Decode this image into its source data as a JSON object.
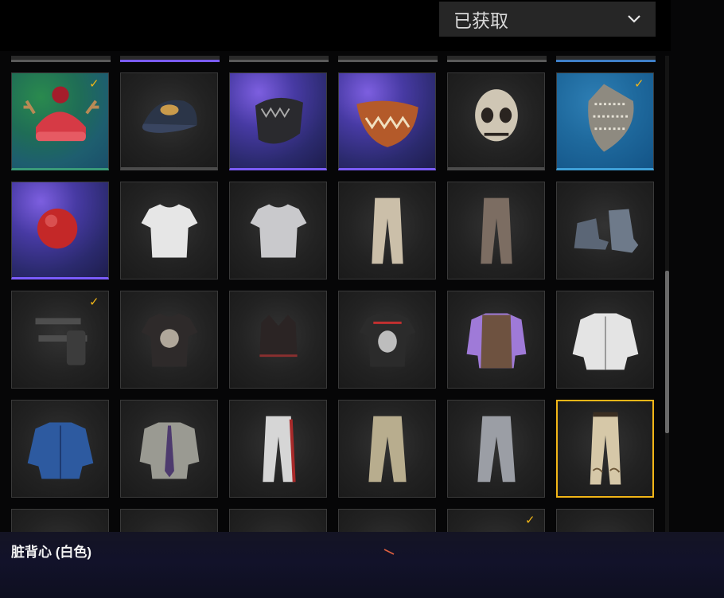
{
  "filter": {
    "selected": "已获取",
    "icon": "chevron-down-icon"
  },
  "selected_item": {
    "name": "脏背心 (白色)"
  },
  "grid": {
    "items": [
      {
        "icon": "red-beanie-antlers-icon",
        "rarity": "holiday",
        "owned": true
      },
      {
        "icon": "baseball-cap-icon",
        "rarity": "common",
        "owned": false
      },
      {
        "icon": "black-mask-icon",
        "rarity": "rare",
        "owned": false
      },
      {
        "icon": "orange-monster-mask-icon",
        "rarity": "rare",
        "owned": false
      },
      {
        "icon": "skull-mask-icon",
        "rarity": "common",
        "owned": false
      },
      {
        "icon": "shemagh-scarf-icon",
        "rarity": "special",
        "owned": true
      },
      {
        "icon": "red-nose-icon",
        "rarity": "rare",
        "owned": false
      },
      {
        "icon": "white-tshirt-icon",
        "rarity": "none",
        "owned": false
      },
      {
        "icon": "gray-tshirt-icon",
        "rarity": "none",
        "owned": false
      },
      {
        "icon": "khaki-pants-icon",
        "rarity": "none",
        "owned": false
      },
      {
        "icon": "brown-pants-icon",
        "rarity": "none",
        "owned": false
      },
      {
        "icon": "gray-boots-icon",
        "rarity": "none",
        "owned": false
      },
      {
        "icon": "thigh-holster-icon",
        "rarity": "none",
        "owned": true
      },
      {
        "icon": "graphic-tshirt-icon",
        "rarity": "none",
        "owned": false
      },
      {
        "icon": "black-sports-bra-icon",
        "rarity": "none",
        "owned": false
      },
      {
        "icon": "skull-tshirt-icon",
        "rarity": "none",
        "owned": false
      },
      {
        "icon": "purple-shirt-vest-icon",
        "rarity": "none",
        "owned": false
      },
      {
        "icon": "white-chinese-shirt-icon",
        "rarity": "none",
        "owned": false
      },
      {
        "icon": "blue-pattern-shirt-icon",
        "rarity": "none",
        "owned": false
      },
      {
        "icon": "gray-shirt-tie-icon",
        "rarity": "none",
        "owned": false
      },
      {
        "icon": "track-pants-icon",
        "rarity": "none",
        "owned": false
      },
      {
        "icon": "cargo-pants-icon",
        "rarity": "none",
        "owned": false
      },
      {
        "icon": "gray-cargo-pants-icon",
        "rarity": "none",
        "owned": false
      },
      {
        "icon": "embroidered-pants-icon",
        "rarity": "none",
        "owned": false,
        "selected": true
      },
      {
        "icon": "partial-item-icon",
        "rarity": "none",
        "owned": false
      },
      {
        "icon": "partial-item-icon",
        "rarity": "none",
        "owned": false
      },
      {
        "icon": "partial-item-icon",
        "rarity": "none",
        "owned": false
      },
      {
        "icon": "partial-item-icon",
        "rarity": "none",
        "owned": false
      },
      {
        "icon": "partial-item-icon",
        "rarity": "none",
        "owned": true
      },
      {
        "icon": "partial-item-icon",
        "rarity": "none",
        "owned": false
      }
    ]
  },
  "colors": {
    "selection": "#f2b617",
    "check": "#f2b617",
    "rare": "#7b5cff",
    "special": "#3fa0d8",
    "holiday": "#3a9a78"
  }
}
